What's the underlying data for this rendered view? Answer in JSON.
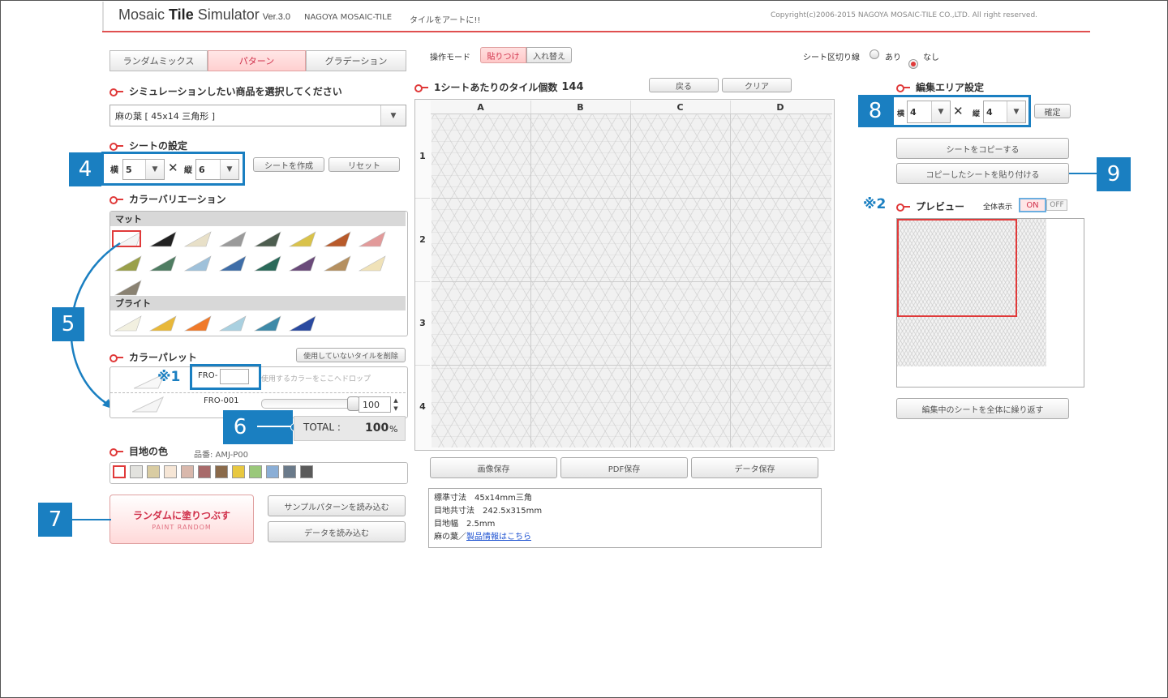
{
  "header": {
    "title_prefix": "Mosaic ",
    "title_bold": "Tile",
    "title_suffix": " Simulator",
    "version": "Ver.3.0",
    "company": "NAGOYA MOSAIC-TILE",
    "tagline": "タイルをアートに!!",
    "copyright": "Copyright(c)2006-2015 NAGOYA MOSAIC-TILE CO.,LTD. All right reserved."
  },
  "tabs": [
    "ランダムミックス",
    "パターン",
    "グラデーション"
  ],
  "product": {
    "title": "シミュレーションしたい商品を選択してください",
    "selected": "麻の葉 [ 45x14 三角形 ]"
  },
  "sheet": {
    "title": "シートの設定",
    "w_label": "横",
    "w_value": "5",
    "times": "✕",
    "h_label": "縦",
    "h_value": "6",
    "create_btn": "シートを作成",
    "reset_btn": "リセット"
  },
  "variation": {
    "title": "カラーバリエーション",
    "matte_label": "マット",
    "bright_label": "ブライト",
    "matte_colors": [
      "#f5f5f5",
      "#222222",
      "#e8e0c8",
      "#9a9a9a",
      "#4d5d4f",
      "#d9c24a",
      "#b85a2a",
      "#e29a9a",
      "#9aa04a",
      "#4f7d62",
      "#9fc1da",
      "#3f6ea8",
      "#2b6a5a",
      "#6a4a7a",
      "#b59060",
      "#f0e2b8",
      "#8a8272"
    ],
    "bright_colors": [
      "#f2f0e0",
      "#e8b83a",
      "#f07a2a",
      "#a9d0e0",
      "#3f8aa8",
      "#2a4aa0"
    ]
  },
  "palette": {
    "title": "カラーパレット",
    "delete_btn": "使用していないタイルを削除",
    "code_prefix": "FRO-",
    "drop_hint": "使用するカラーをここへドロップ",
    "item_code": "FRO-001",
    "item_value": "100",
    "item_level": 1.0,
    "total_label": "TOTAL :",
    "total_value": "100",
    "total_unit": "%"
  },
  "joint": {
    "title": "目地の色",
    "code_label": "品番: AMJ-P00",
    "colors": [
      "#ffffff",
      "#e2e2de",
      "#d9cca2",
      "#f6e6d6",
      "#d9b8ac",
      "#a86a6a",
      "#8a6a4a",
      "#e8c840",
      "#9ac87a",
      "#8aaed6",
      "#6a7a8a",
      "#5a5a5a"
    ]
  },
  "actions": {
    "random_label": "ランダムに塗りつぶす",
    "random_sub": "PAINT RANDOM",
    "sample_btn": "サンプルパターンを読み込む",
    "data_load_btn": "データを読み込む"
  },
  "center": {
    "mode_label": "操作モード",
    "mode_paste": "貼りつけ",
    "mode_swap": "入れ替え",
    "count_label": "1シートあたりのタイル個数",
    "count_value": "144",
    "back_btn": "戻る",
    "clear_btn": "クリア",
    "cols": [
      "A",
      "B",
      "C",
      "D"
    ],
    "rows": [
      "1",
      "2",
      "3",
      "4"
    ],
    "save_image": "画像保存",
    "save_pdf": "PDF保存",
    "save_data": "データ保存",
    "info": {
      "line1": "標準寸法　45x14mm三角",
      "line2": "目地共寸法　242.5x315mm",
      "line3": "目地幅　2.5mm",
      "product_prefix": "麻の葉／",
      "product_link": "製品情報はこちら"
    }
  },
  "right": {
    "divider_label": "シート区切り線",
    "yes_label": "あり",
    "no_label": "なし",
    "edit_title": "編集エリア設定",
    "w_label": "横",
    "w_value": "4",
    "times": "✕",
    "h_label": "縦",
    "h_value": "4",
    "confirm_btn": "確定",
    "copy_btn": "シートをコピーする",
    "paste_btn": "コピーしたシートを貼り付ける",
    "preview_title": "プレビュー",
    "fullview_label": "全体表示",
    "on_label": "ON",
    "off_label": "OFF",
    "repeat_btn": "編集中のシートを全体に繰り返す"
  },
  "annotations": {
    "c4": "4",
    "c5": "5",
    "c6": "6",
    "c7": "7",
    "c8": "8",
    "c9": "9",
    "note1": "※1",
    "note2": "※2"
  }
}
